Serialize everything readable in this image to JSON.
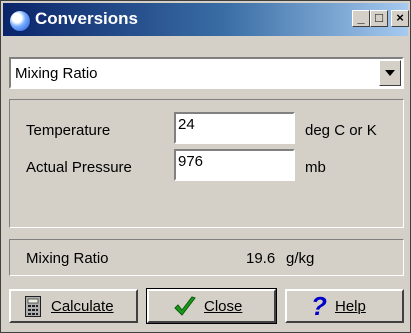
{
  "window": {
    "title": "Conversions"
  },
  "titlebar_buttons": {
    "minimize": "_",
    "maximize": "□",
    "close": "×"
  },
  "conversion_select": {
    "value": "Mixing Ratio"
  },
  "fields": [
    {
      "label": "Temperature",
      "value": "24",
      "unit": "deg C or K"
    },
    {
      "label": "Actual Pressure",
      "value": "976",
      "unit": "mb"
    }
  ],
  "result": {
    "label": "Mixing Ratio",
    "value": "19.6",
    "unit": "g/kg"
  },
  "buttons": {
    "calculate": "Calculate",
    "close": "Close",
    "help": "Help"
  },
  "icons": {
    "app": "globe-icon",
    "calculate": "calculator-icon",
    "close": "checkmark-icon",
    "help": "question-icon"
  },
  "colors": {
    "titlebar_start": "#0a246a",
    "titlebar_end": "#a6caf0",
    "checkmark": "#1a9a1a",
    "help": "#0000c8"
  }
}
